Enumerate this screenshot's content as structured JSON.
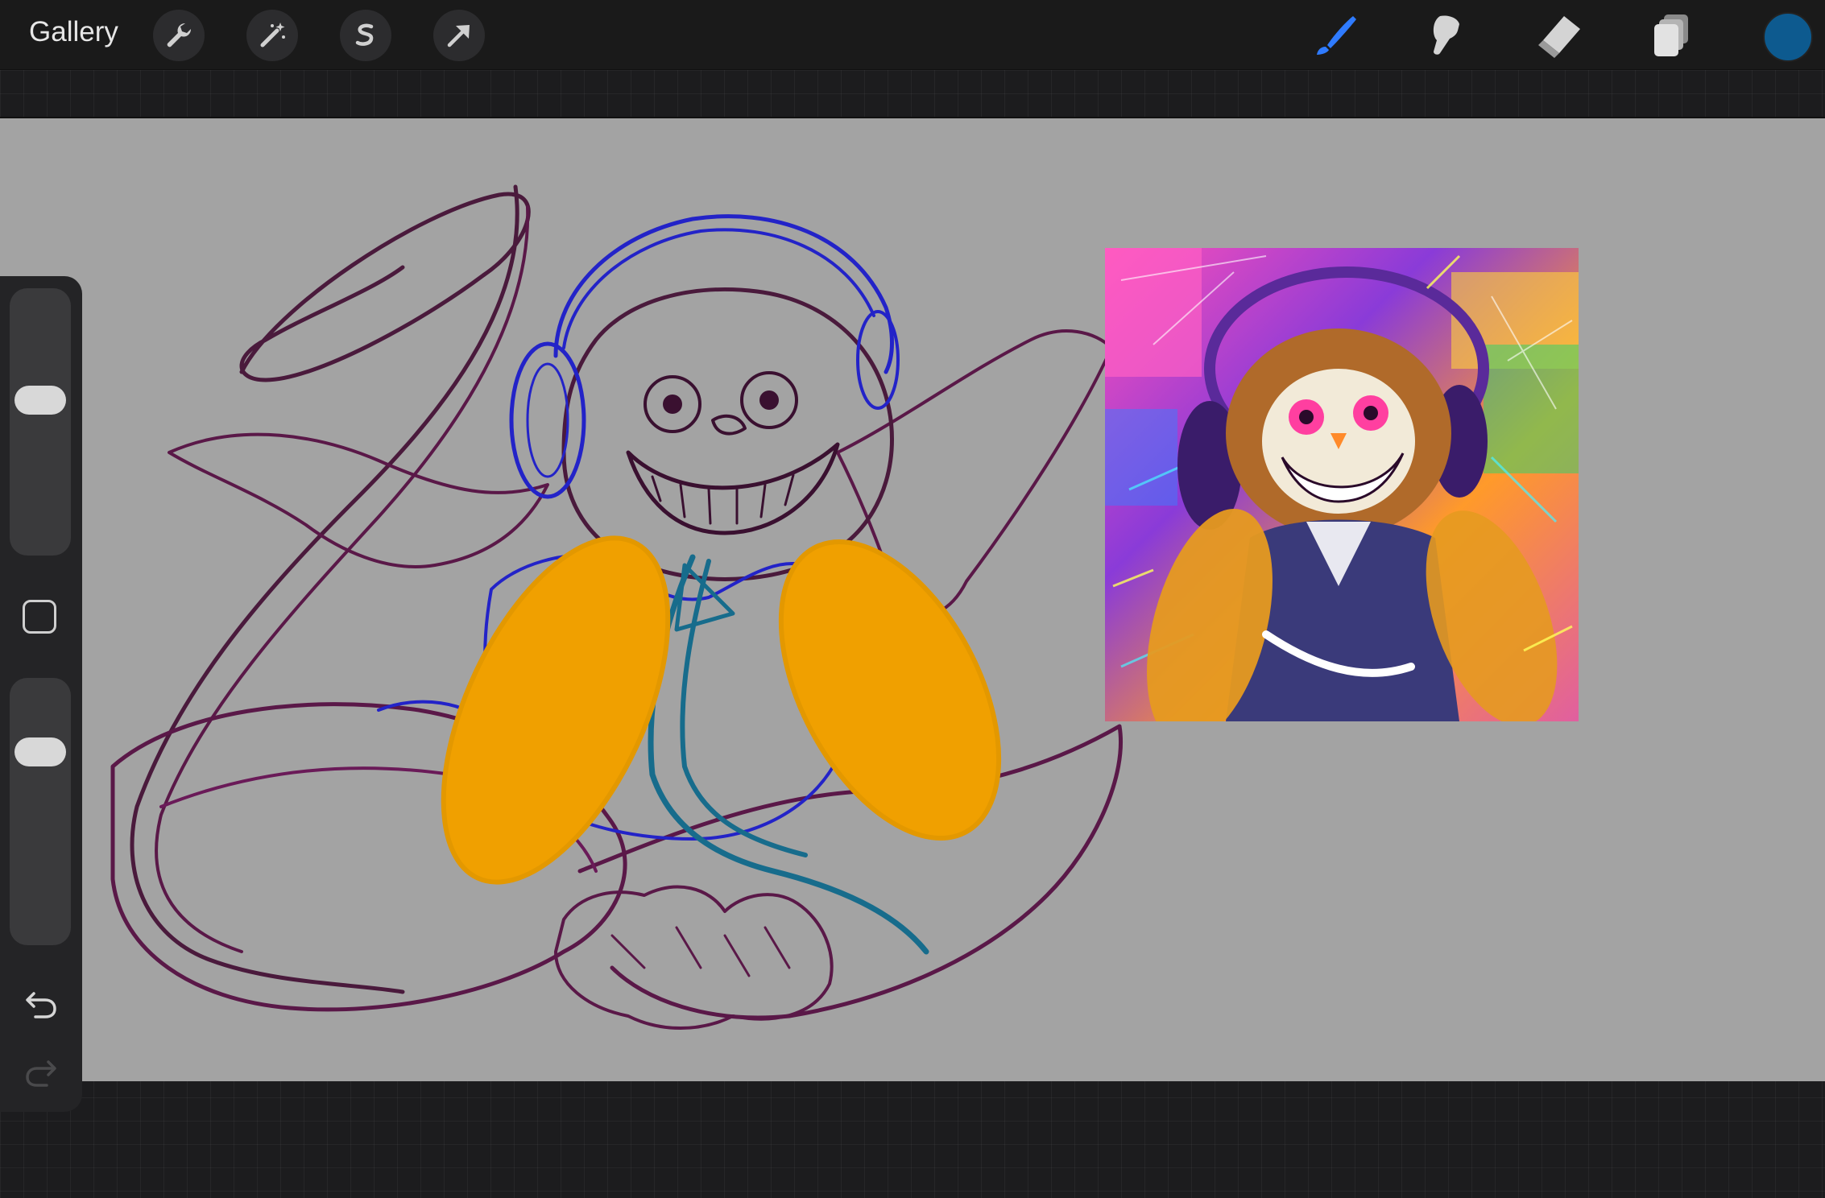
{
  "app": {
    "gallery_label": "Gallery"
  },
  "toolbar": {
    "left_tools": [
      "wrench-icon",
      "magic-wand-icon",
      "selection-icon",
      "move-icon"
    ],
    "right_tools": [
      "brush-icon",
      "smudge-icon",
      "eraser-icon",
      "layers-icon"
    ],
    "active_tool": "brush-icon",
    "current_color": "#0d5a8f",
    "active_tool_color": "#2f7bff"
  },
  "colors": {
    "canvas": "#a3a3a3",
    "sketch_purple": "#5a1848",
    "sketch_blue": "#2323c8",
    "sketch_teal": "#176c8c",
    "sketch_orange": "#f0a000"
  },
  "sidebar": {
    "brush_size_level": 0.37,
    "opacity_level": 0.26,
    "undo_icon": "undo-icon",
    "redo_icon": "redo-icon"
  }
}
